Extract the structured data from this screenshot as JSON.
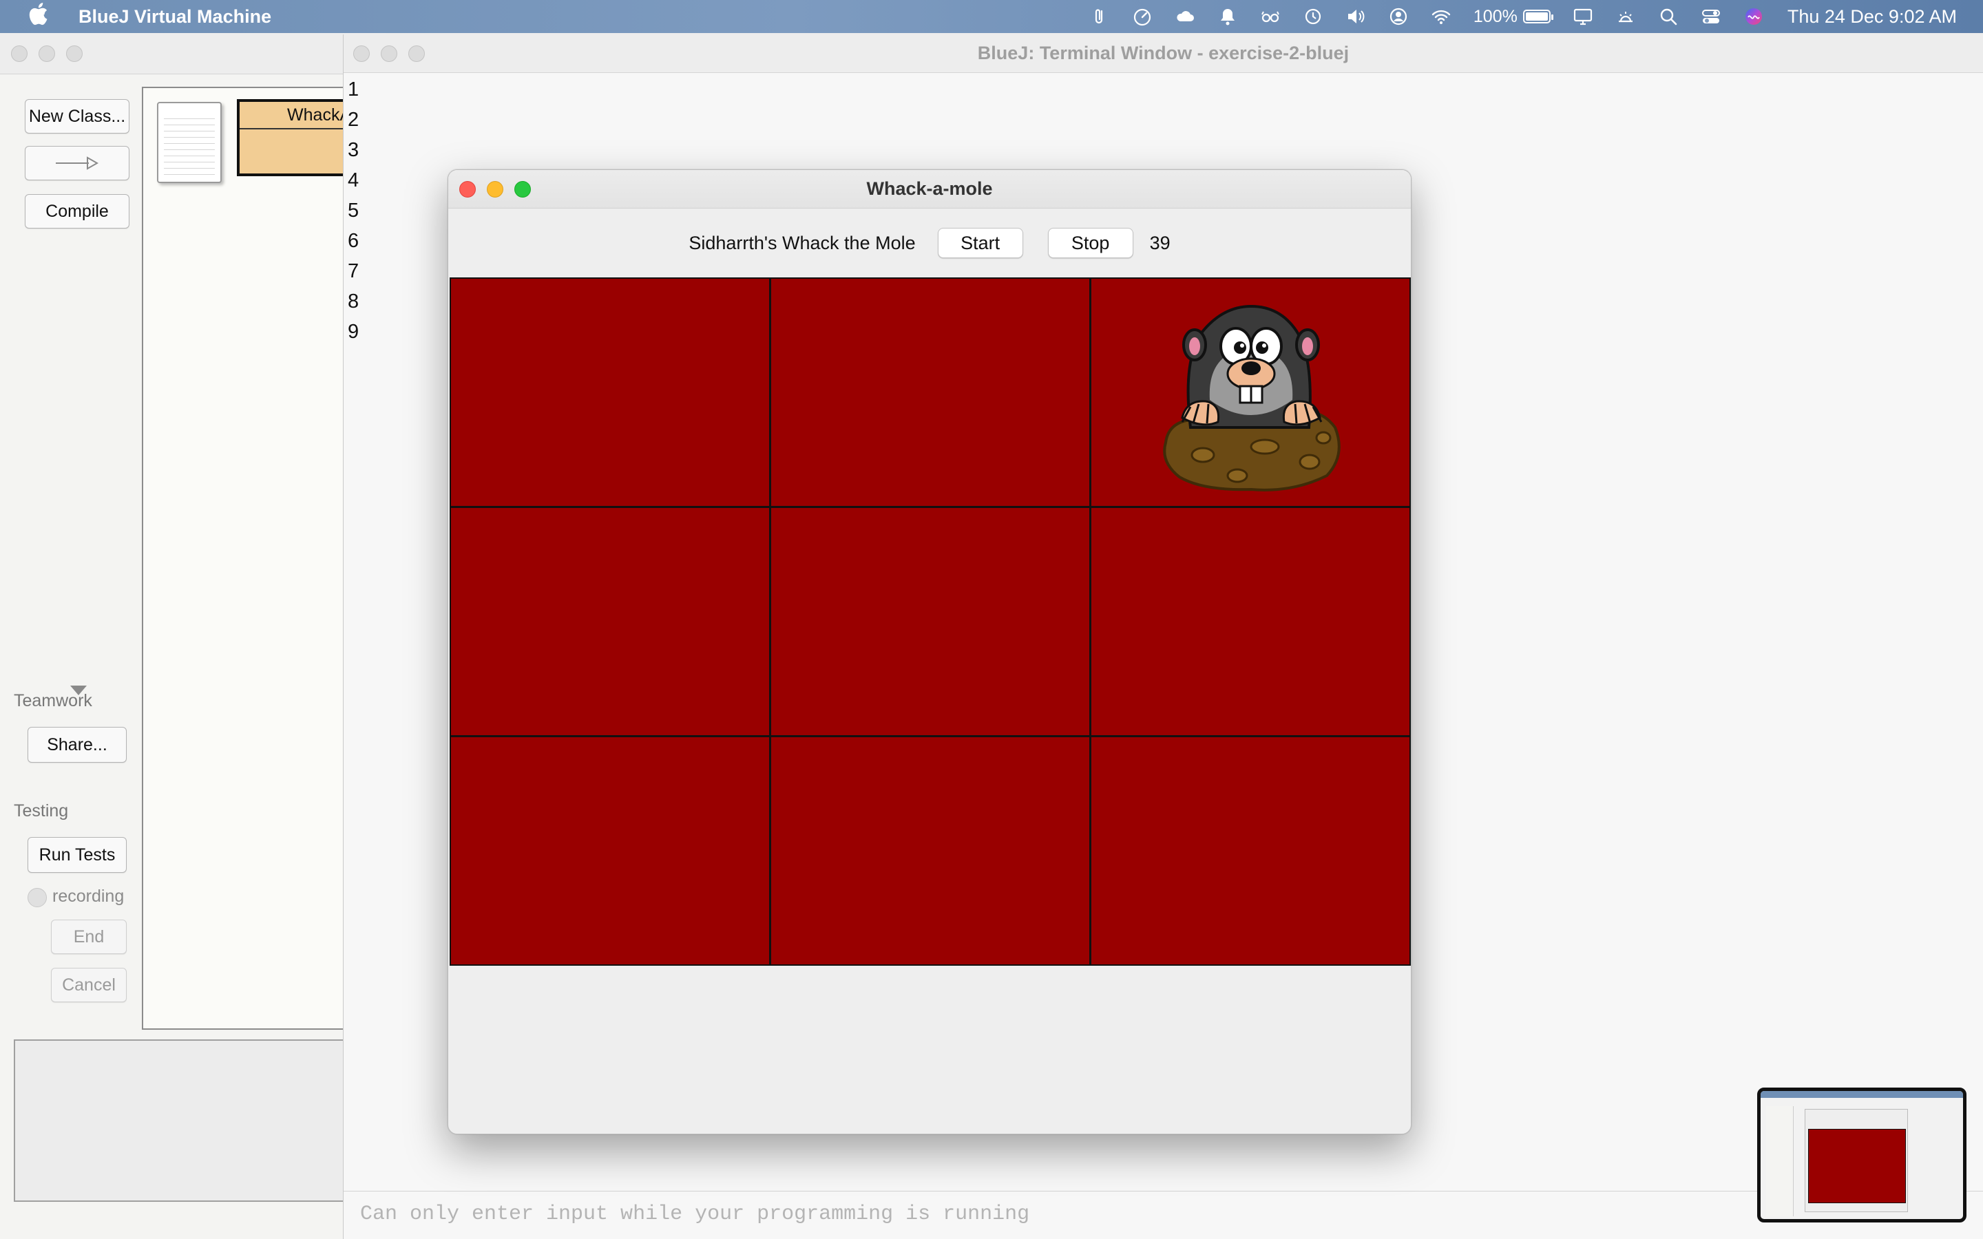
{
  "menubar": {
    "app_name": "BlueJ Virtual Machine",
    "battery_percent": "100%",
    "clock": "Thu 24 Dec  9:02 AM",
    "icons": [
      "apple-icon",
      "paperclip-icon",
      "speedometer-icon",
      "cloud-icon",
      "notification-icon",
      "glasses-icon",
      "time-machine-icon",
      "volume-icon",
      "user-icon",
      "wifi-icon",
      "battery-icon",
      "display-icon",
      "brightness-icon",
      "search-icon",
      "control-center-icon",
      "siri-icon"
    ]
  },
  "bluej": {
    "buttons": {
      "new_class": "New Class...",
      "compile": "Compile",
      "share": "Share...",
      "run_tests": "Run Tests",
      "end": "End",
      "cancel": "Cancel"
    },
    "labels": {
      "teamwork": "Teamwork",
      "testing": "Testing",
      "recording": "recording"
    },
    "class_name": "WhackAM"
  },
  "terminal": {
    "title": "BlueJ: Terminal Window - exercise-2-bluej",
    "lines": [
      "1",
      "2",
      "3",
      "4",
      "5",
      "6",
      "7",
      "8",
      "9"
    ],
    "input_placeholder": "Can only enter input while your programming is running"
  },
  "game": {
    "title": "Whack-a-mole",
    "heading": "Sidharrth's Whack the Mole",
    "start_label": "Start",
    "stop_label": "Stop",
    "score": "39",
    "cell_color": "#990000",
    "mole_cell": 3
  }
}
